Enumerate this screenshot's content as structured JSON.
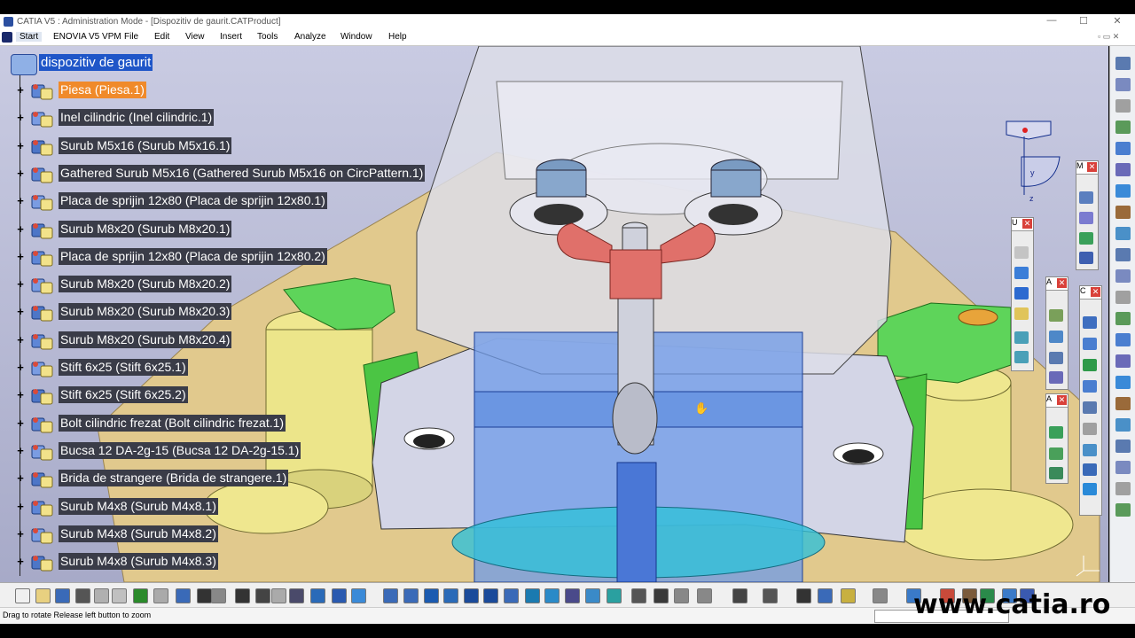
{
  "window": {
    "title": "CATIA V5 : Administration Mode - [Dispozitiv de gaurit.CATProduct]",
    "controls": {
      "minimize": "—",
      "maximize": "☐",
      "close": "✕"
    }
  },
  "menu": {
    "start": "Start",
    "items": [
      "ENOVIA V5 VPM",
      "File",
      "Edit",
      "View",
      "Insert",
      "Tools",
      "Analyze",
      "Window",
      "Help"
    ]
  },
  "tree": {
    "root": "dispozitiv de gaurit",
    "items": [
      {
        "label": "Piesa (Piesa.1)",
        "selected": true
      },
      {
        "label": "Inel cilindric (Inel cilindric.1)"
      },
      {
        "label": "Surub M5x16 (Surub M5x16.1)"
      },
      {
        "label": "Gathered Surub M5x16 (Gathered Surub M5x16 on CircPattern.1)"
      },
      {
        "label": "Placa de sprijin 12x80 (Placa de sprijin 12x80.1)"
      },
      {
        "label": "Surub M8x20 (Surub M8x20.1)"
      },
      {
        "label": "Placa de sprijin 12x80 (Placa de sprijin 12x80.2)"
      },
      {
        "label": "Surub M8x20 (Surub M8x20.2)"
      },
      {
        "label": "Surub M8x20 (Surub M8x20.3)"
      },
      {
        "label": "Surub M8x20 (Surub M8x20.4)"
      },
      {
        "label": "Stift 6x25 (Stift 6x25.1)"
      },
      {
        "label": "Stift 6x25 (Stift 6x25.2)"
      },
      {
        "label": "Bolt cilindric frezat (Bolt cilindric frezat.1)"
      },
      {
        "label": "Bucsa 12 DA-2g-15 (Bucsa 12 DA-2g-15.1)"
      },
      {
        "label": "Brida de strangere (Brida de strangere.1)"
      },
      {
        "label": "Surub M4x8 (Surub M4x8.1)"
      },
      {
        "label": "Surub M4x8 (Surub M4x8.2)"
      },
      {
        "label": "Surub M4x8 (Surub M4x8.3)"
      }
    ]
  },
  "toolbars": {
    "t1_head": "M",
    "t2_head": "U",
    "t3_head": "A",
    "t4_head": "C",
    "t5_head": "A"
  },
  "compass": {
    "y_label": "y",
    "z_label": "z"
  },
  "status": {
    "message": "Drag to rotate  Release left button to zoom"
  },
  "watermark": "www.catia.ro",
  "colors": {
    "tree_label_bg": "#3a3c48",
    "selected": "#f08a2a",
    "root": "#1f56c8",
    "viewport_bg": "#b8bbd6",
    "wing_nut": "#e0706a",
    "clamp_green": "#5ed45a",
    "yellow_part": "#ede68a",
    "blue_part": "#6d9ae8"
  }
}
